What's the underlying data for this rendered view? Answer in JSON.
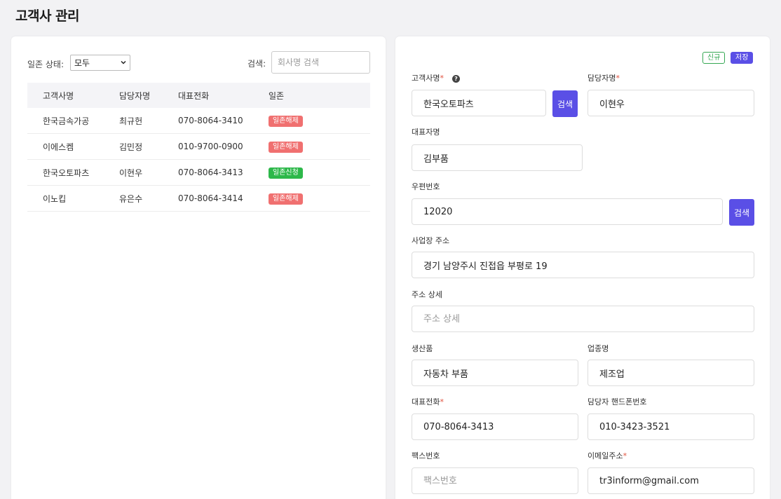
{
  "page": {
    "title": "고객사 관리"
  },
  "filter": {
    "status_label": "일존 상태:",
    "status_value": "모두",
    "search_label": "검색:",
    "search_placeholder": "회사명 검색"
  },
  "table": {
    "headers": [
      "고객사명",
      "담당자명",
      "대표전화",
      "일존"
    ],
    "rows": [
      {
        "company": "한국금속가공",
        "manager": "최규헌",
        "phone": "070-8064-3410",
        "status": "일존해제",
        "status_color": "#f07070"
      },
      {
        "company": "이에스켐",
        "manager": "김민정",
        "phone": "010-9700-0900",
        "status": "일존해제",
        "status_color": "#f07070"
      },
      {
        "company": "한국오토파츠",
        "manager": "이현우",
        "phone": "070-8064-3413",
        "status": "일존신청",
        "status_color": "#2db84a"
      },
      {
        "company": "이노킵",
        "manager": "유은수",
        "phone": "070-8064-3414",
        "status": "일존해제",
        "status_color": "#f07070"
      }
    ]
  },
  "form": {
    "new_tag": "신규",
    "save_tag": "저장",
    "required_mark": "*",
    "help_icon": "?",
    "search_button": "검색",
    "company_label": "고객사명",
    "company_value": "한국오토파츠",
    "manager_label": "담당자명",
    "manager_value": "이현우",
    "ceo_label": "대표자명",
    "ceo_value": "김부품",
    "zip_label": "우편번호",
    "zip_value": "12020",
    "address_label": "사업장 주소",
    "address_value": "경기 남양주시 진접읍 부평로 19",
    "detail_label": "주소 상세",
    "detail_placeholder": "주소 상세",
    "product_label": "생산품",
    "product_value": "자동차 부품",
    "industry_label": "업종명",
    "industry_value": "제조업",
    "phone_label": "대표전화",
    "phone_value": "070-8064-3413",
    "mobile_label": "담당자 핸드폰번호",
    "mobile_value": "010-3423-3521",
    "fax_label": "팩스번호",
    "fax_placeholder": "팩스번호",
    "email_label": "이메일주소",
    "email_value": "tr3inform@gmail.com"
  },
  "colors": {
    "accent": "#5a4fe6",
    "required": "#e0503c",
    "new_tag": "#35a853"
  }
}
